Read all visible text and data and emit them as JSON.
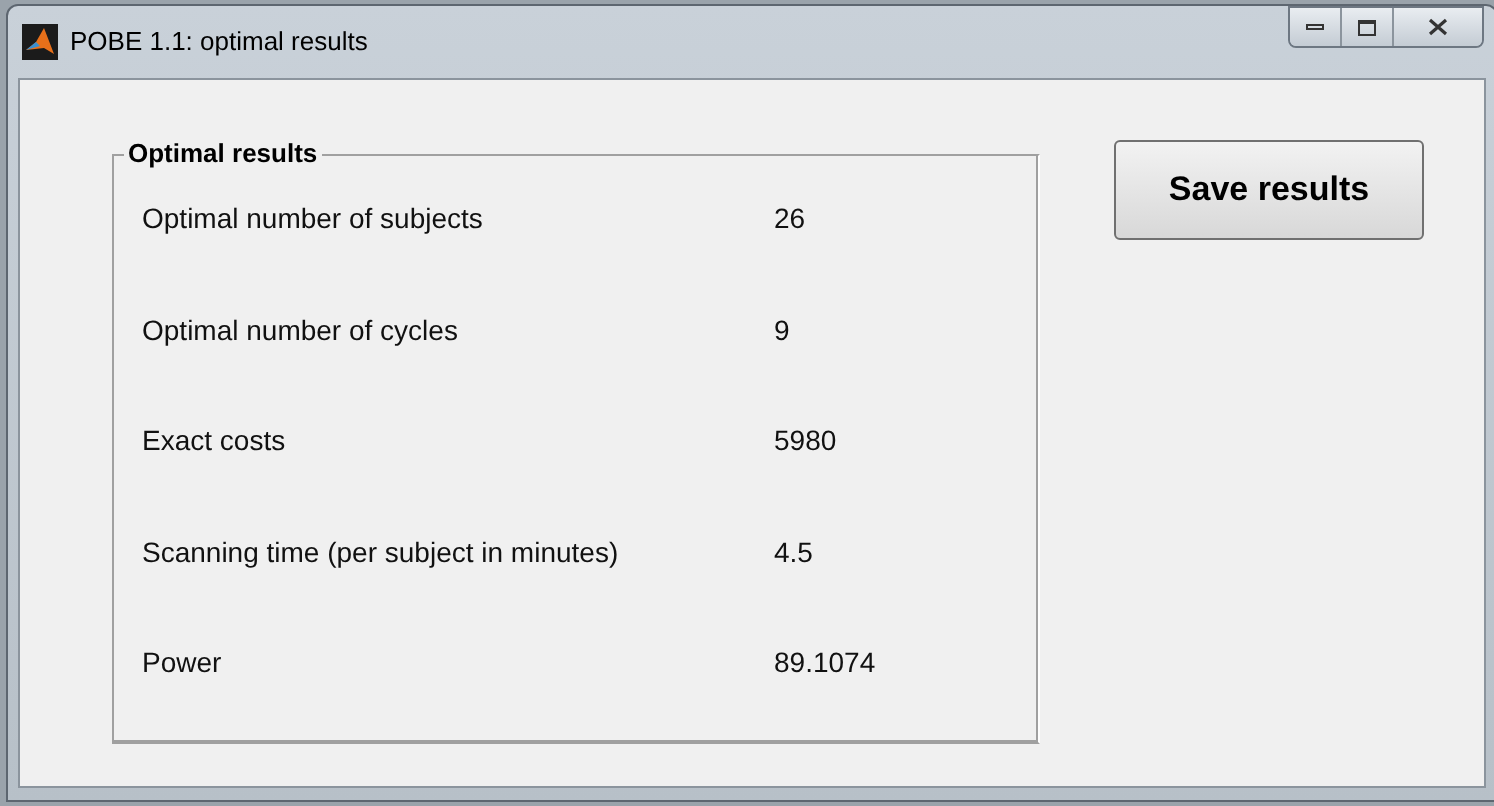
{
  "window": {
    "title": "POBE 1.1: optimal results"
  },
  "group": {
    "title": "Optimal results",
    "rows": [
      {
        "label": "Optimal number of subjects",
        "value": "26"
      },
      {
        "label": "Optimal number of cycles",
        "value": "9"
      },
      {
        "label": "Exact costs",
        "value": "5980"
      },
      {
        "label": "Scanning time (per subject in minutes)",
        "value": "4.5"
      },
      {
        "label": "Power",
        "value": "89.1074"
      }
    ]
  },
  "buttons": [
    "Save results"
  ]
}
